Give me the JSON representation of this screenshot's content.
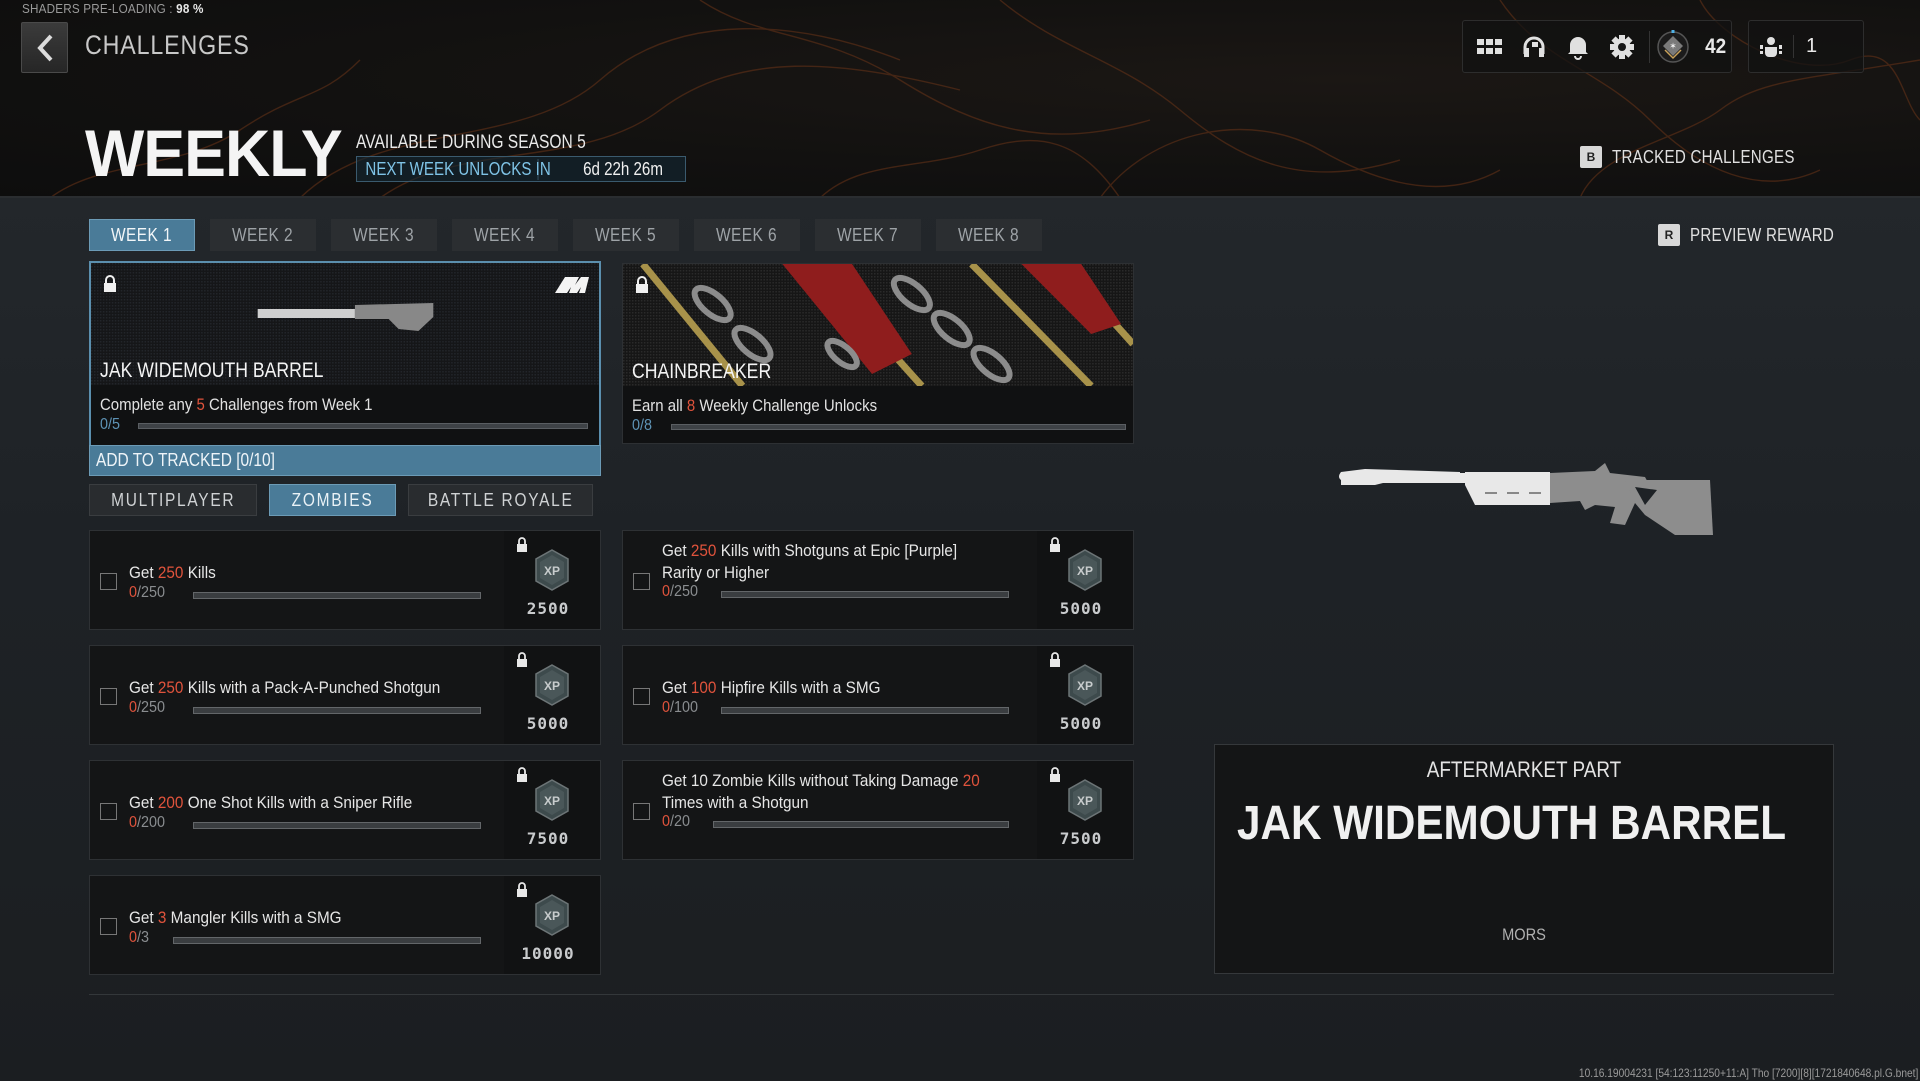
{
  "system": {
    "shader_label": "SHADERS PRE-LOADING : ",
    "shader_percent": "98 %",
    "build_info": "10.16.19004231 [54:123:11250+11:A] Tho [7200][8][1721840648.pl.G.bnet]"
  },
  "header": {
    "breadcrumb": "CHALLENGES",
    "title": "WEEKLY",
    "availability": "AVAILABLE DURING SEASON 5",
    "unlock_label": "NEXT WEEK UNLOCKS IN",
    "unlock_time": "6d 22h 26m",
    "icons": [
      "apps-grid-icon",
      "headset-icon",
      "bell-icon",
      "gear-icon",
      "rank-badge-icon"
    ],
    "rank_level": "42",
    "party_count": "1",
    "tracked_key": "B",
    "tracked_label": "TRACKED CHALLENGES",
    "preview_key": "R",
    "preview_label": "PREVIEW REWARD"
  },
  "week_tabs": [
    {
      "label": "WEEK 1",
      "active": true
    },
    {
      "label": "WEEK 2",
      "active": false
    },
    {
      "label": "WEEK 3",
      "active": false
    },
    {
      "label": "WEEK 4",
      "active": false
    },
    {
      "label": "WEEK 5",
      "active": false
    },
    {
      "label": "WEEK 6",
      "active": false
    },
    {
      "label": "WEEK 7",
      "active": false
    },
    {
      "label": "WEEK 8",
      "active": false
    }
  ],
  "reward_cards": [
    {
      "name": "JAK WIDEMOUTH BARREL",
      "desc_pre": "Complete any ",
      "desc_num": "5",
      "desc_post": " Challenges from Week 1",
      "progress_text": "0/5",
      "progress": 0,
      "brand_mark": "JAK",
      "locked": true,
      "selected": true
    },
    {
      "name": "CHAINBREAKER",
      "desc_pre": "Earn all ",
      "desc_num": "8",
      "desc_post": " Weekly Challenge Unlocks",
      "progress_text": "0/8",
      "progress": 0,
      "locked": true,
      "selected": false
    }
  ],
  "track_button": "ADD TO TRACKED [0/10]",
  "mode_tabs": [
    {
      "label": "MULTIPLAYER",
      "active": false
    },
    {
      "label": "ZOMBIES",
      "active": true
    },
    {
      "label": "BATTLE ROYALE",
      "active": false
    }
  ],
  "challenges": [
    {
      "pre": "Get ",
      "num": "250",
      "post": " Kills",
      "current": "0",
      "target": "/250",
      "progress": 0,
      "xp": "2500",
      "locked": true
    },
    {
      "pre": "Get ",
      "num": "250",
      "post": " Kills with Shotguns at Epic [Purple] Rarity or Higher",
      "current": "0",
      "target": "/250",
      "progress": 0,
      "xp": "5000",
      "locked": true
    },
    {
      "pre": "Get ",
      "num": "250",
      "post": " Kills with a Pack-A-Punched Shotgun",
      "current": "0",
      "target": "/250",
      "progress": 0,
      "xp": "5000",
      "locked": true
    },
    {
      "pre": "Get ",
      "num": "100",
      "post": " Hipfire Kills with a SMG",
      "current": "0",
      "target": "/100",
      "progress": 0,
      "xp": "5000",
      "locked": true
    },
    {
      "pre": "Get ",
      "num": "200",
      "post": " One Shot Kills with a Sniper Rifle",
      "current": "0",
      "target": "/200",
      "progress": 0,
      "xp": "7500",
      "locked": true
    },
    {
      "pre": "Get 10 Zombie Kills without Taking Damage ",
      "num": "20",
      "post": " Times with a Shotgun",
      "current": "0",
      "target": "/20",
      "progress": 0,
      "xp": "7500",
      "locked": true
    },
    {
      "pre": "Get ",
      "num": "3",
      "post": " Mangler Kills with a SMG",
      "current": "0",
      "target": "/3",
      "progress": 0,
      "xp": "10000",
      "locked": true
    }
  ],
  "preview": {
    "type": "AFTERMARKET PART",
    "name": "JAK WIDEMOUTH BARREL",
    "brand": "MORS"
  },
  "colors": {
    "accent_blue": "#4a7b98",
    "highlight_red": "#e0533c",
    "progress_blue": "#5e93b5"
  }
}
